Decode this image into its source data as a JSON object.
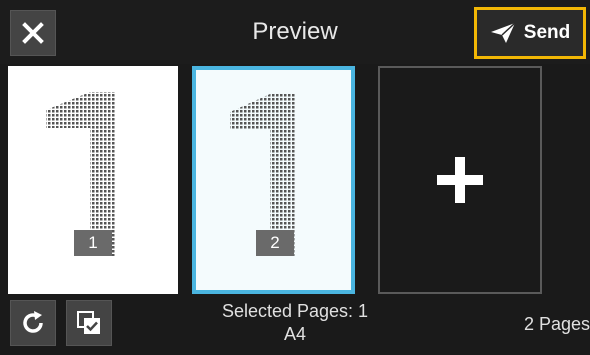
{
  "header": {
    "title": "Preview",
    "close_icon": "close-icon",
    "send_label": "Send",
    "send_icon": "paper-plane-icon",
    "send_highlight_color": "#f2b705"
  },
  "pages": [
    {
      "number": "1",
      "selected": false
    },
    {
      "number": "2",
      "selected": true
    }
  ],
  "add_page": {
    "icon": "plus-icon"
  },
  "footer": {
    "rotate_icon": "rotate-icon",
    "select_icon": "select-pages-icon",
    "selected_pages_label": "Selected Pages: 1",
    "paper_size": "A4",
    "page_count": "2 Pages"
  },
  "colors": {
    "background": "#1a1a1a",
    "selection_border": "#4ab5e0",
    "button_bg": "#444444"
  }
}
